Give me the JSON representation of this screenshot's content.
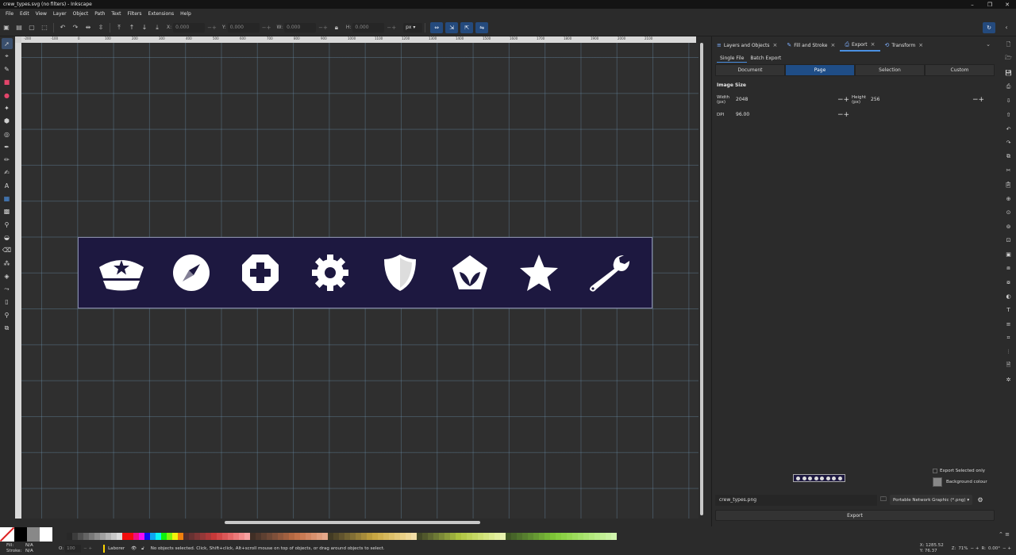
{
  "window": {
    "title": "crew_types.svg (no filters) - Inkscape"
  },
  "menu": [
    "File",
    "Edit",
    "View",
    "Layer",
    "Object",
    "Path",
    "Text",
    "Filters",
    "Extensions",
    "Help"
  ],
  "toolbar": {
    "x_label": "X:",
    "x_value": "0.000",
    "y_label": "Y:",
    "y_value": "0.000",
    "w_label": "W:",
    "w_value": "0.000",
    "h_label": "H:",
    "h_value": "0.000",
    "unit": "px"
  },
  "ruler_ticks": [
    "-200",
    "-100",
    "0",
    "100",
    "200",
    "300",
    "400",
    "500",
    "600",
    "700",
    "800",
    "900",
    "1000",
    "1100",
    "1200",
    "1300",
    "1400",
    "1500",
    "1600",
    "1700",
    "1800",
    "1900",
    "2000",
    "2100"
  ],
  "canvas": {
    "page_background": "#1d1840",
    "icons": [
      "police-cap-icon",
      "compass-icon",
      "medical-cross-icon",
      "gear-icon",
      "shield-icon",
      "leaf-pentagon-icon",
      "star-icon",
      "wrench-icon"
    ]
  },
  "panel": {
    "tabs": [
      {
        "label": "Layers and Objects",
        "icon": "layers-icon",
        "active": false
      },
      {
        "label": "Fill and Stroke",
        "icon": "fill-stroke-icon",
        "active": false
      },
      {
        "label": "Export",
        "icon": "export-icon",
        "active": true
      },
      {
        "label": "Transform",
        "icon": "transform-icon",
        "active": false
      }
    ],
    "subtabs": {
      "single": "Single File",
      "batch": "Batch Export"
    },
    "area": {
      "document": "Document",
      "page": "Page",
      "selection": "Selection",
      "custom": "Custom"
    },
    "image_size": {
      "title": "Image Size",
      "width_label": "Width (px)",
      "width_value": "2048",
      "height_label": "Height (px)",
      "height_value": "256",
      "dpi_label": "DPI",
      "dpi_value": "96.00"
    },
    "export_selected_only": "Export Selected only",
    "background_colour": "Background colour",
    "filename": "crew_types.png",
    "filetype": "Portable Network Graphic (*.png)",
    "export_button": "Export"
  },
  "status": {
    "fill_label": "Fill:",
    "fill_value": "N/A",
    "stroke_label": "Stroke:",
    "stroke_value": "N/A",
    "opacity_label": "O:",
    "opacity_value": "100",
    "layer": "Laborer",
    "message": "No objects selected. Click, Shift+click, Alt+scroll mouse on top of objects, or drag around objects to select.",
    "x_label": "X:",
    "x_value": "1285.52",
    "y_label": "Y:",
    "y_value": "76.37",
    "zoom_label": "Z:",
    "zoom_value": "71%",
    "rotation_label": "R:",
    "rotation_value": "0.00°"
  },
  "colors": {
    "accent": "#4a90e2",
    "active_segment": "#1f4d86",
    "layer_indicator": "#ffd400"
  }
}
